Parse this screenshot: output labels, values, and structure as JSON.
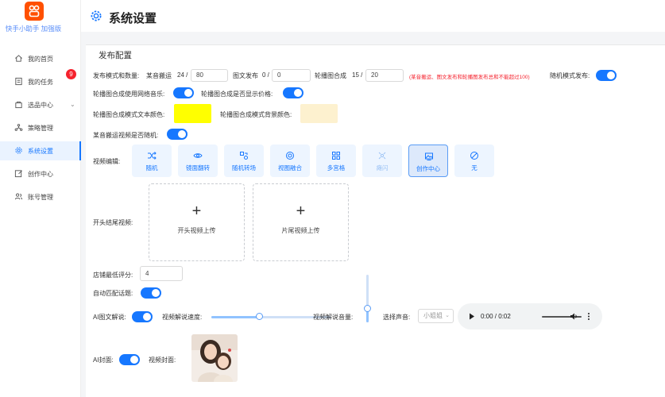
{
  "app": {
    "name": "快手小助手 加强版",
    "brand_color": "#ff5000",
    "accent": "#1677ff"
  },
  "sidebar": {
    "items": [
      {
        "label": "我的首页",
        "icon": "home-icon"
      },
      {
        "label": "我的任务",
        "icon": "task-icon",
        "badge": "9"
      },
      {
        "label": "选品中心",
        "icon": "bag-icon"
      },
      {
        "label": "策略管理",
        "icon": "strategy-icon"
      },
      {
        "label": "系统设置",
        "icon": "gear-icon",
        "active": true
      },
      {
        "label": "创作中心",
        "icon": "edit-icon"
      },
      {
        "label": "账号管理",
        "icon": "users-icon"
      }
    ]
  },
  "header": {
    "title": "系统设置"
  },
  "section": {
    "title": "发布配置"
  },
  "publish": {
    "mode_label": "发布模式和数量:",
    "move_label": "某音搬运",
    "move_count": "24 /",
    "move_value": "80",
    "graphic_label": "图文发布",
    "graphic_count": "0 /",
    "graphic_value": "0",
    "carousel_label": "轮播图合成",
    "carousel_count": "15 /",
    "carousel_value": "20",
    "note": "(某音搬运、图文发布和轮播图发布总和不能超过100)",
    "random_label": "随机模式发布:"
  },
  "carousel": {
    "music_label": "轮播图合成使用网络音乐:",
    "price_label": "轮播图合成是否显示价格:",
    "text_color_label": "轮播图合成模式文本颜色:",
    "text_color": "#ffff00",
    "bg_color_label": "轮播图合成模式背景颜色:",
    "bg_color": "#fdf1cf"
  },
  "move_random_label": "某音搬运视频是否随机:",
  "video_edit": {
    "label": "视频编辑:",
    "options": [
      {
        "label": "随机",
        "icon": "shuffle-icon"
      },
      {
        "label": "镜面翻转",
        "icon": "mirror-icon"
      },
      {
        "label": "随机转场",
        "icon": "transition-icon"
      },
      {
        "label": "视图融合",
        "icon": "blend-icon"
      },
      {
        "label": "多宫格",
        "icon": "grid-icon"
      },
      {
        "label": "瘫闪",
        "icon": "flash-icon"
      },
      {
        "label": "创作中心",
        "icon": "image-icon"
      },
      {
        "label": "无",
        "icon": "none-icon"
      }
    ]
  },
  "intro_outro": {
    "label": "开头结尾视频:",
    "intro_label": "开头视频上传",
    "outro_label": "片尾视频上传"
  },
  "min_score": {
    "label": "店铺最低评分:",
    "value": "4"
  },
  "auto_topic_label": "自动匹配话题:",
  "ai_narration": {
    "label": "AI图文解说:",
    "speed_label": "视频解说速度:",
    "speed": 0.4,
    "volume_label": "视频解说音量:",
    "volume": 0.3,
    "voice_label": "选择声音:",
    "voice_value": "小姐姐"
  },
  "audio": {
    "time": "0:00 / 0:02"
  },
  "ai_cover": {
    "label": "AI封面:",
    "cover_label": "视频封面:"
  }
}
